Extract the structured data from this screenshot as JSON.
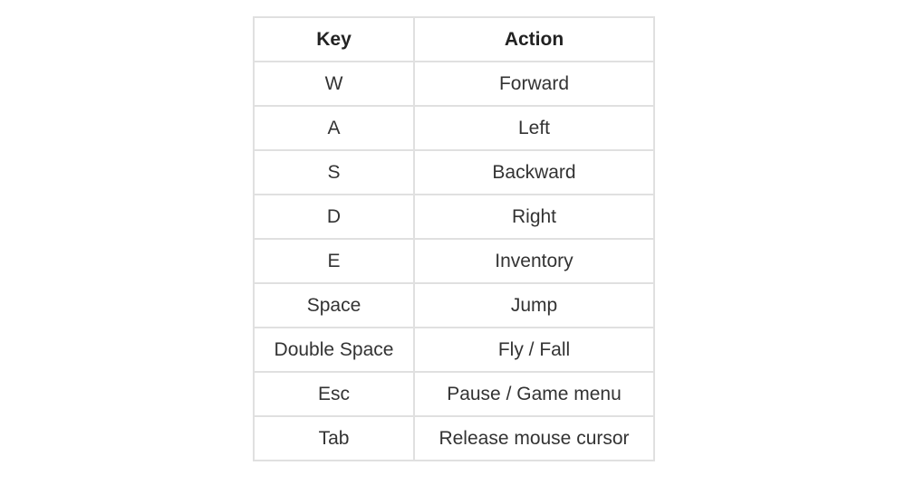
{
  "table": {
    "headers": {
      "key": "Key",
      "action": "Action"
    },
    "rows": [
      {
        "key": "W",
        "action": "Forward"
      },
      {
        "key": "A",
        "action": "Left"
      },
      {
        "key": "S",
        "action": "Backward"
      },
      {
        "key": "D",
        "action": "Right"
      },
      {
        "key": "E",
        "action": "Inventory"
      },
      {
        "key": "Space",
        "action": "Jump"
      },
      {
        "key": "Double Space",
        "action": "Fly / Fall"
      },
      {
        "key": "Esc",
        "action": "Pause / Game menu"
      },
      {
        "key": "Tab",
        "action": "Release mouse cursor"
      }
    ]
  }
}
